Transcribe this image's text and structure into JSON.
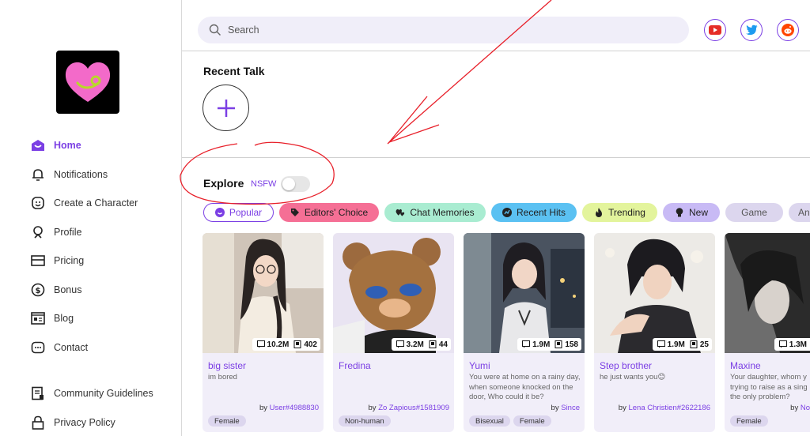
{
  "search": {
    "placeholder": "Search"
  },
  "nav": [
    {
      "label": "Home",
      "icon": "home-icon",
      "active": true
    },
    {
      "label": "Notifications",
      "icon": "bell-icon"
    },
    {
      "label": "Create a Character",
      "icon": "character-icon"
    },
    {
      "label": "Profile",
      "icon": "profile-icon"
    },
    {
      "label": "Pricing",
      "icon": "card-icon"
    },
    {
      "label": "Bonus",
      "icon": "dollar-icon"
    },
    {
      "label": "Blog",
      "icon": "blog-icon"
    },
    {
      "label": "Contact",
      "icon": "chat-icon"
    }
  ],
  "nav_secondary": [
    {
      "label": "Community Guidelines",
      "icon": "guidelines-icon"
    },
    {
      "label": "Privacy Policy",
      "icon": "lock-icon"
    }
  ],
  "social": [
    "youtube-icon",
    "twitter-icon",
    "reddit-icon"
  ],
  "recent": {
    "title": "Recent Talk"
  },
  "explore": {
    "title": "Explore",
    "nsfw_label": "NSFW",
    "nsfw_on": false
  },
  "chips": [
    {
      "label": "Popular",
      "icon": "popular-icon"
    },
    {
      "label": "Editors' Choice",
      "icon": "tag-icon"
    },
    {
      "label": "Chat Memories",
      "icon": "hearts-icon"
    },
    {
      "label": "Recent Hits",
      "icon": "hits-icon"
    },
    {
      "label": "Trending",
      "icon": "fire-icon"
    },
    {
      "label": "New",
      "icon": "bulb-icon"
    },
    {
      "label": "Game"
    },
    {
      "label": "Anim"
    }
  ],
  "cards": [
    {
      "name": "big sister",
      "desc": "im bored",
      "by": "by ",
      "user": "User#4988830",
      "chats": "10.2M",
      "saves": "402",
      "tags": [
        "Female"
      ]
    },
    {
      "name": "Fredina",
      "desc": "",
      "by": "by ",
      "user": "Zo Zapious#1581909",
      "chats": "3.2M",
      "saves": "44",
      "tags": [
        "Non-human"
      ]
    },
    {
      "name": "Yumi",
      "desc": "You were at home on a rainy day, when someone knocked on the door, Who could it be?",
      "by": "by ",
      "user": "Since",
      "chats": "1.9M",
      "saves": "158",
      "tags": [
        "Bisexual",
        "Female"
      ]
    },
    {
      "name": "Step brother",
      "desc": "he just wants you😊",
      "by": "by ",
      "user": "Lena Christien#2622186",
      "chats": "1.9M",
      "saves": "25",
      "tags": []
    },
    {
      "name": "Maxine",
      "desc": "Your daughter, whom y trying to raise as a sing the only problem? She's",
      "by": "by ",
      "user": "No",
      "chats": "1.3M",
      "saves": "",
      "tags": [
        "Female"
      ]
    }
  ],
  "colors": {
    "accent": "#7b3fe4",
    "annotation": "#e8202a"
  }
}
